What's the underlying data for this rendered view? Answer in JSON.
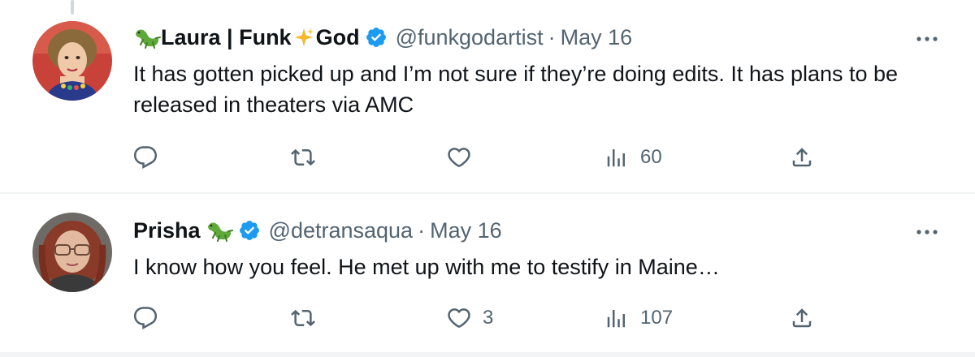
{
  "tweets": [
    {
      "display_name_pre": "Laura | Funk",
      "display_name_post": "God",
      "emojis": [
        "lizard-icon",
        "sparkle-icon"
      ],
      "verified": true,
      "handle": "@funkgodartist",
      "separator": "·",
      "date": "May 16",
      "text": "It has gotten picked up and I’m not sure if they’re doing edits. It has plans to be released in theaters via AMC",
      "actions": {
        "reply_count": "",
        "retweet_count": "",
        "like_count": "",
        "views_count": "60"
      }
    },
    {
      "display_name_pre": "Prisha",
      "emojis": [
        "lizard-icon"
      ],
      "verified": true,
      "handle": "@detransaqua",
      "separator": "·",
      "date": "May 16",
      "text": "I know how you feel. He met up with me to testify in Maine…",
      "actions": {
        "reply_count": "",
        "retweet_count": "",
        "like_count": "3",
        "views_count": "107"
      }
    }
  ],
  "colors": {
    "text_primary": "#0f1419",
    "text_secondary": "#536471",
    "verified_blue": "#1d9bf0",
    "divider": "#eff3f4"
  }
}
